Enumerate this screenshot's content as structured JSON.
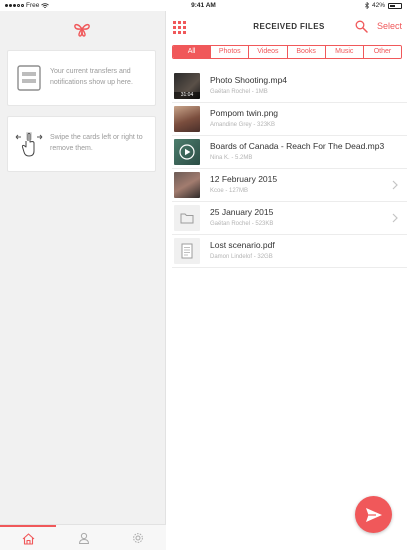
{
  "status_bar": {
    "carrier": "Free",
    "time": "9:41 AM",
    "battery": "42%"
  },
  "sidebar": {
    "cards": [
      {
        "text": "Your current transfers and notifications show up here."
      },
      {
        "text": "Swipe the cards left or right to remove them."
      }
    ]
  },
  "header": {
    "title": "RECEIVED FILES",
    "select_label": "Select"
  },
  "filters": [
    "All",
    "Photos",
    "Videos",
    "Books",
    "Music",
    "Other"
  ],
  "active_filter": "All",
  "files": [
    {
      "name": "Photo Shooting.mp4",
      "meta": "Gaëtan Rochel - 1MB",
      "duration": "31:04"
    },
    {
      "name": "Pompom twin.png",
      "meta": "Amandine Grey - 323KB"
    },
    {
      "name": "Boards of Canada - Reach For The Dead.mp3",
      "meta": "Nina K. - 5.2MB"
    },
    {
      "name": "12 February 2015",
      "meta": "Kcoe - 127MB"
    },
    {
      "name": "25 January 2015",
      "meta": "Gaëtan Rochel - 523KB"
    },
    {
      "name": "Lost scenario.pdf",
      "meta": "Damon Lindelof - 32GB"
    }
  ],
  "colors": {
    "accent": "#f0585a",
    "sidebar_bg": "#f1f1f1"
  }
}
